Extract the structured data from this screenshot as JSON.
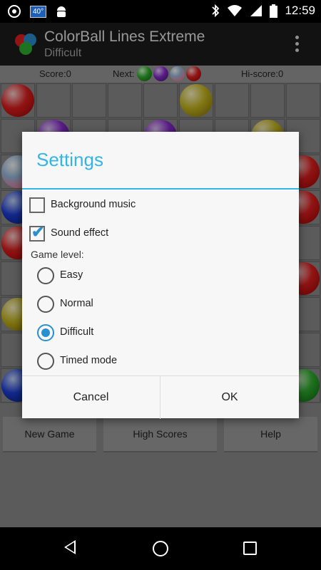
{
  "status_bar": {
    "time": "12:59",
    "temperature": "40°",
    "icons": [
      "app-icon",
      "weather-icon",
      "android-icon",
      "bluetooth-icon",
      "wifi-icon",
      "signal-icon",
      "battery-icon"
    ]
  },
  "app_bar": {
    "title": "ColorBall Lines Extreme",
    "subtitle": "Difficult"
  },
  "scoreboard": {
    "score_label": "Score:0",
    "next_label": "Next:",
    "hiscore_label": "Hi-score:0",
    "next_balls": [
      "green",
      "purple",
      "multi",
      "red"
    ]
  },
  "board": {
    "balls": [
      {
        "row": 0,
        "col": 0,
        "color": "red"
      },
      {
        "row": 0,
        "col": 5,
        "color": "yellow"
      },
      {
        "row": 1,
        "col": 1,
        "color": "purple"
      },
      {
        "row": 1,
        "col": 4,
        "color": "purple"
      },
      {
        "row": 1,
        "col": 7,
        "color": "yellow"
      },
      {
        "row": 2,
        "col": 0,
        "color": "multi"
      },
      {
        "row": 2,
        "col": 8,
        "color": "red"
      },
      {
        "row": 3,
        "col": 0,
        "color": "blue"
      },
      {
        "row": 3,
        "col": 8,
        "color": "red"
      },
      {
        "row": 4,
        "col": 0,
        "color": "red"
      },
      {
        "row": 5,
        "col": 8,
        "color": "red"
      },
      {
        "row": 6,
        "col": 0,
        "color": "yellow"
      },
      {
        "row": 8,
        "col": 0,
        "color": "blue"
      },
      {
        "row": 8,
        "col": 8,
        "color": "green"
      }
    ]
  },
  "game_buttons": {
    "new_game": "New Game",
    "high_scores": "High Scores",
    "help": "Help"
  },
  "dialog": {
    "title": "Settings",
    "background_music": {
      "label": "Background music",
      "checked": false
    },
    "sound_effect": {
      "label": "Sound effect",
      "checked": true
    },
    "game_level_label": "Game level:",
    "levels": [
      {
        "label": "Easy",
        "selected": false
      },
      {
        "label": "Normal",
        "selected": false
      },
      {
        "label": "Difficult",
        "selected": true
      },
      {
        "label": "Timed mode",
        "selected": false
      }
    ],
    "cancel": "Cancel",
    "ok": "OK"
  },
  "colors": {
    "accent": "#33b5e5",
    "check": "#2a8fce"
  }
}
